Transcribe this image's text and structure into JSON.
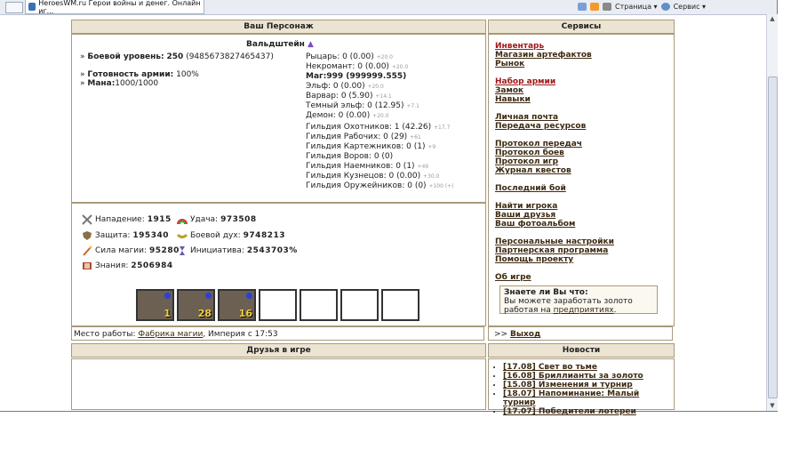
{
  "browser": {
    "tab_title": "HeroesWM.ru Герои войны и денег. Онлайн иг...",
    "tools": [
      "Страница ▾",
      "Сервис ▾"
    ]
  },
  "character": {
    "header": "Ваш Персонаж",
    "name": "Вальдштейн",
    "left_stats": [
      {
        "label": "Боевой уровень:",
        "value": "250",
        "extra": "(9485673827465437)"
      },
      {
        "label": "Готовность армии:",
        "value": "100%",
        "extra": ""
      },
      {
        "label": "Мана:",
        "value": "1000/1000",
        "extra": ""
      }
    ],
    "factions": [
      {
        "text": "Рыцарь: 0 (0.00)",
        "small": "+20.0",
        "bold": false
      },
      {
        "text": "Некромант: 0 (0.00)",
        "small": "+20.0",
        "bold": false
      },
      {
        "text": "Маг:999 (999999.555)",
        "small": "",
        "bold": true
      },
      {
        "text": "Эльф: 0 (0.00)",
        "small": "+20.0",
        "bold": false
      },
      {
        "text": "Варвар: 0 (5.90)",
        "small": "+14.1",
        "bold": false
      },
      {
        "text": "Темный эльф: 0 (12.95)",
        "small": "+7.1",
        "bold": false
      },
      {
        "text": "Демон: 0 (0.00)",
        "small": "+20.0",
        "bold": false
      }
    ],
    "guilds": [
      {
        "text": "Гильдия Охотников: 1 (42.26)",
        "small": "+17.7"
      },
      {
        "text": "Гильдия Рабочих: 0 (29)",
        "small": "+61"
      },
      {
        "text": "Гильдия Картежников: 0 (1)",
        "small": "+9"
      },
      {
        "text": "Гильдия Воров: 0 (0)",
        "small": ""
      },
      {
        "text": "Гильдия Наемников: 0 (1)",
        "small": "+49"
      },
      {
        "text": "Гильдия Кузнецов: 0 (0.00)",
        "small": "+30.0"
      },
      {
        "text": "Гильдия Оружейников: 0 (0)",
        "small": "+100 (+)"
      }
    ]
  },
  "stats": [
    {
      "label": "Нападение:",
      "value": "1915",
      "icon": "sword-icon"
    },
    {
      "label": "Удача:",
      "value": "973508",
      "icon": "rainbow-icon"
    },
    {
      "label": "Защита:",
      "value": "195340",
      "icon": "shield-icon"
    },
    {
      "label": "Боевой дух:",
      "value": "9748213",
      "icon": "morale-icon"
    },
    {
      "label": "Сила магии:",
      "value": "95280",
      "icon": "wand-icon"
    },
    {
      "label": "Инициатива:",
      "value": "2543703%",
      "icon": "hourglass-icon"
    },
    {
      "label": "Знания:",
      "value": "2506984",
      "icon": "book-icon"
    }
  ],
  "army": [
    "1",
    "28",
    "16",
    "",
    "",
    "",
    ""
  ],
  "workplace": {
    "prefix": "Место работы:",
    "link": "Фабрика магии",
    "suffix": ", Империя с 17:53"
  },
  "friends": {
    "header": "Друзья в игре"
  },
  "services": {
    "header": "Сервисы",
    "groups": [
      [
        {
          "t": "Инвентарь",
          "red": true
        },
        {
          "t": "Магазин артефактов"
        },
        {
          "t": "Рынок"
        }
      ],
      [
        {
          "t": "Набор армии",
          "red": true
        },
        {
          "t": "Замок"
        },
        {
          "t": "Навыки"
        }
      ],
      [
        {
          "t": "Личная почта"
        },
        {
          "t": "Передача ресурсов"
        }
      ],
      [
        {
          "t": "Протокол передач"
        },
        {
          "t": "Протокол боев"
        },
        {
          "t": "Протокол игр"
        },
        {
          "t": "Журнал квестов"
        }
      ],
      [
        {
          "t": "Последний бой"
        }
      ],
      [
        {
          "t": "Найти игрока"
        },
        {
          "t": "Ваши друзья"
        },
        {
          "t": "Ваш фотоальбом"
        }
      ],
      [
        {
          "t": "Персональные настройки"
        },
        {
          "t": "Партнерская программа"
        },
        {
          "t": "Помощь проекту"
        }
      ],
      [
        {
          "t": "Об игре"
        }
      ]
    ],
    "tip_title": "Знаете ли Вы что:",
    "tip_text": "Вы можете заработать золото работая на ",
    "tip_link": "предприятиях",
    "exit_prefix": ">>",
    "exit": "Выход"
  },
  "news": {
    "header": "Новости",
    "items": [
      "[17.08] Свет во тьме",
      "[16.08] Бриллианты за золото",
      "[15.08] Изменения и турнир",
      "[18.07] Напоминание: Малый турнир",
      "[17.07] Победители лотереи"
    ]
  }
}
